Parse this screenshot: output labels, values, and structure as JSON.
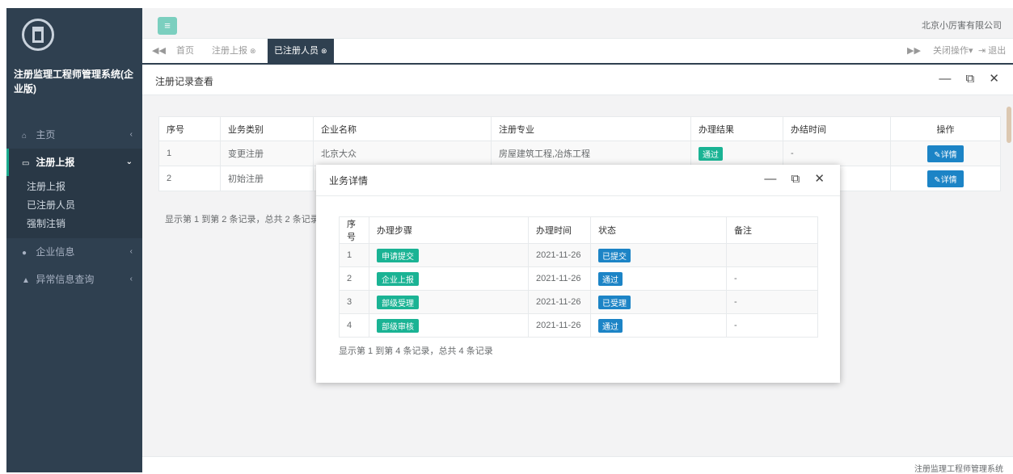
{
  "sidebar": {
    "system_title": "注册监理工程师管理系统(企业版)",
    "items": [
      {
        "icon": "home-icon",
        "label": "主页",
        "arrow": "‹"
      },
      {
        "icon": "monitor-icon",
        "label": "注册上报",
        "arrow": "⌄"
      },
      {
        "icon": "user-icon",
        "label": "企业信息",
        "arrow": "‹"
      },
      {
        "icon": "warning-icon",
        "label": "异常信息查询",
        "arrow": "‹"
      }
    ],
    "sub_items": [
      "注册上报",
      "已注册人员",
      "强制注销"
    ]
  },
  "header": {
    "menu_icon": "menu-icon",
    "company": "北京小厉害有限公司"
  },
  "tabs": {
    "prev": "◀◀",
    "items": [
      {
        "label": "首页"
      },
      {
        "label": "注册上报",
        "close": "⊗"
      },
      {
        "label": "已注册人员",
        "close": "⊗"
      }
    ],
    "next": "▶▶",
    "close_ops": "关闭操作▾",
    "logout": "退出"
  },
  "panel": {
    "title": "注册记录查看",
    "controls": "— ⧉ ✕"
  },
  "records": {
    "columns": [
      "序号",
      "业务类别",
      "企业名称",
      "注册专业",
      "办理结果",
      "办结时间",
      "操作"
    ],
    "rows": [
      {
        "no": "1",
        "type": "变更注册",
        "company": "北京大众",
        "major": "房屋建筑工程,冶炼工程",
        "result": "通过",
        "time": "-",
        "action": "详情"
      },
      {
        "no": "2",
        "type": "初始注册",
        "company": "",
        "major": "",
        "result": "",
        "time": "",
        "action": "详情"
      }
    ],
    "summary": "显示第 1 到第 2 条记录，总共 2 条记录"
  },
  "modal": {
    "title": "业务详情",
    "controls": "— ⧉ ✕",
    "columns": [
      "序号",
      "办理步骤",
      "办理时间",
      "状态",
      "备注"
    ],
    "rows": [
      {
        "no": "1",
        "step": "申请提交",
        "time": "2021-11-26",
        "status": "已提交",
        "note": ""
      },
      {
        "no": "2",
        "step": "企业上报",
        "time": "2021-11-26",
        "status": "通过",
        "note": "-"
      },
      {
        "no": "3",
        "step": "部级受理",
        "time": "2021-11-26",
        "status": "已受理",
        "note": "-"
      },
      {
        "no": "4",
        "step": "部级审核",
        "time": "2021-11-26",
        "status": "通过",
        "note": "-"
      }
    ],
    "summary": "显示第 1 到第 4 条记录，总共 4 条记录"
  },
  "footer": {
    "text": "注册监理工程师管理系统"
  },
  "colors": {
    "sidebar": "#2f4050",
    "primary": "#1ab394",
    "info": "#1c84c6"
  }
}
